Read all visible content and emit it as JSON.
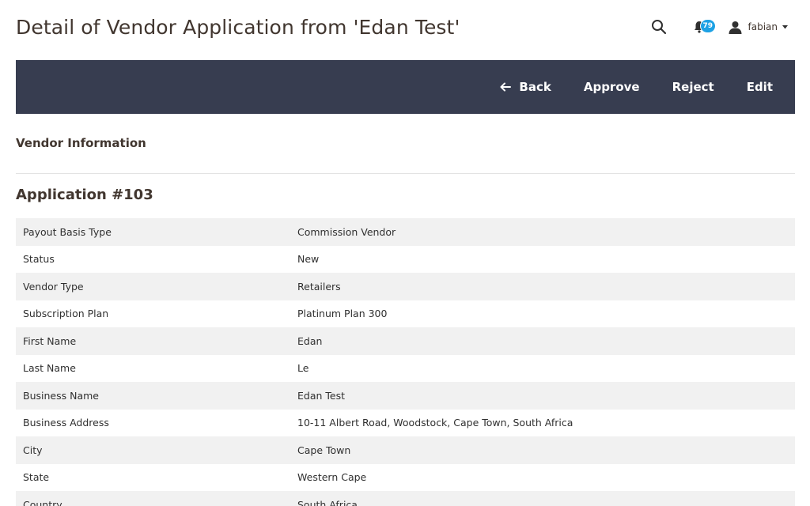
{
  "header": {
    "title": "Detail of Vendor Application from 'Edan Test'",
    "notification_count": "79",
    "user_name": "fabian"
  },
  "toolbar": {
    "back_label": "Back",
    "approve_label": "Approve",
    "reject_label": "Reject",
    "edit_label": "Edit"
  },
  "section": {
    "title": "Vendor Information",
    "application_heading": "Application #103"
  },
  "rows": [
    {
      "label": "Payout Basis Type",
      "value": "Commission Vendor"
    },
    {
      "label": "Status",
      "value": "New"
    },
    {
      "label": "Vendor Type",
      "value": "Retailers"
    },
    {
      "label": "Subscription Plan",
      "value": "Platinum Plan 300"
    },
    {
      "label": "First Name",
      "value": "Edan"
    },
    {
      "label": "Last Name",
      "value": "Le"
    },
    {
      "label": "Business Name",
      "value": "Edan Test"
    },
    {
      "label": "Business Address",
      "value": "10-11 Albert Road, Woodstock, Cape Town, South Africa"
    },
    {
      "label": "City",
      "value": "Cape Town"
    },
    {
      "label": "State",
      "value": "Western Cape"
    },
    {
      "label": "Country",
      "value": "South Africa"
    }
  ],
  "colors": {
    "toolbar_bg": "#373d50",
    "badge": "#1da1e4",
    "row_alt": "#f1f1f1"
  },
  "icons": [
    "search-icon",
    "bell-icon",
    "user-icon",
    "caret-down-icon",
    "arrow-left-icon"
  ]
}
